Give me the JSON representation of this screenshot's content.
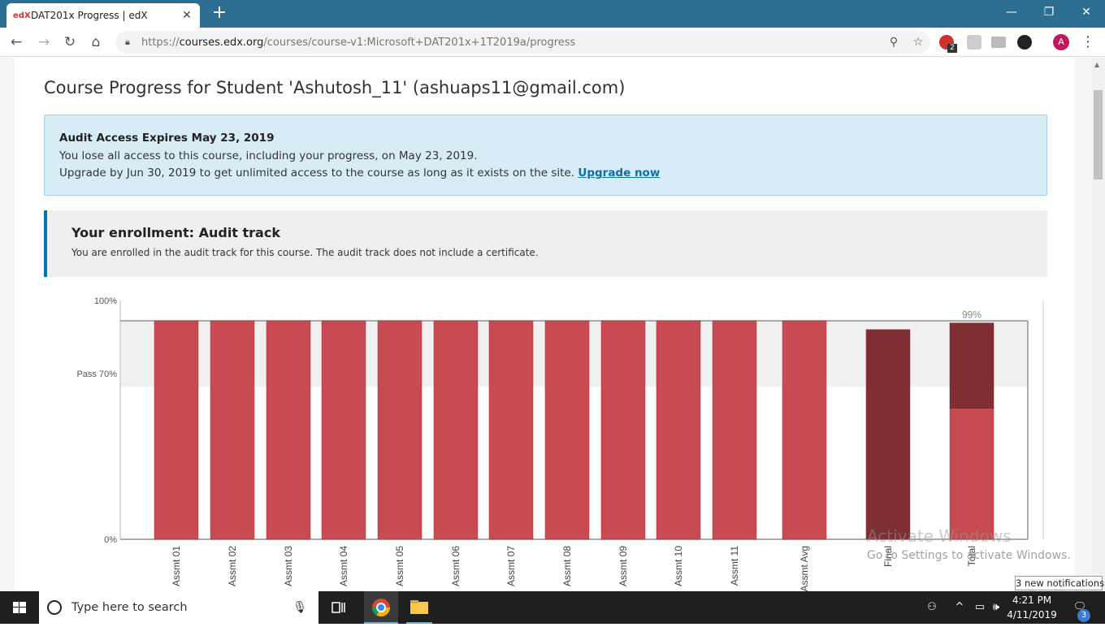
{
  "browser": {
    "tab_title": "DAT201x Progress | edX",
    "favicon_text": "edX",
    "new_tab": "+",
    "url_prefix": "https://",
    "url_domain": "courses.edx.org",
    "url_path": "/courses/course-v1:Microsoft+DAT201x+1T2019a/progress",
    "profile_initial": "A",
    "extension_badge": "2"
  },
  "page": {
    "title": "Course Progress for Student 'Ashutosh_11' (ashuaps11@gmail.com)",
    "audit": {
      "heading": "Audit Access Expires May 23, 2019",
      "line1": "You lose all access to this course, including your progress, on May 23, 2019.",
      "line2": "Upgrade by Jun 30, 2019 to get unlimited access to the course as long as it exists on the site.",
      "upgrade_link": "Upgrade now"
    },
    "enrollment": {
      "heading": "Your enrollment: Audit track",
      "description": "You are enrolled in the audit track for this course. The audit track does not include a certificate."
    }
  },
  "chart_data": {
    "type": "bar",
    "y_ticks": [
      "100%",
      "Pass 70%",
      "0%"
    ],
    "pass_threshold": 70,
    "ylim": [
      0,
      100
    ],
    "categories": [
      "Assmt 01",
      "Assmt 02",
      "Assmt 03",
      "Assmt 04",
      "Assmt 05",
      "Assmt 06",
      "Assmt 07",
      "Assmt 08",
      "Assmt 09",
      "Assmt 10",
      "Assmt 11",
      "Assmt Avg",
      "Final",
      "Total"
    ],
    "values": [
      100,
      100,
      100,
      100,
      100,
      100,
      100,
      100,
      100,
      100,
      100,
      100,
      96,
      99
    ],
    "total_breakdown": {
      "assessments": 60,
      "final": 39
    },
    "total_label": "99%",
    "colors": {
      "bar": "#c74b50",
      "final": "#7f2e32",
      "band": "#f0f0f0"
    }
  },
  "watermark": {
    "line1": "Activate Windows",
    "line2": "Go to Settings to activate Windows."
  },
  "taskbar": {
    "search_placeholder": "Type here to search",
    "time": "4:21 PM",
    "date": "4/11/2019",
    "notification_count": "3",
    "notification_toast": "3 new notifications"
  }
}
